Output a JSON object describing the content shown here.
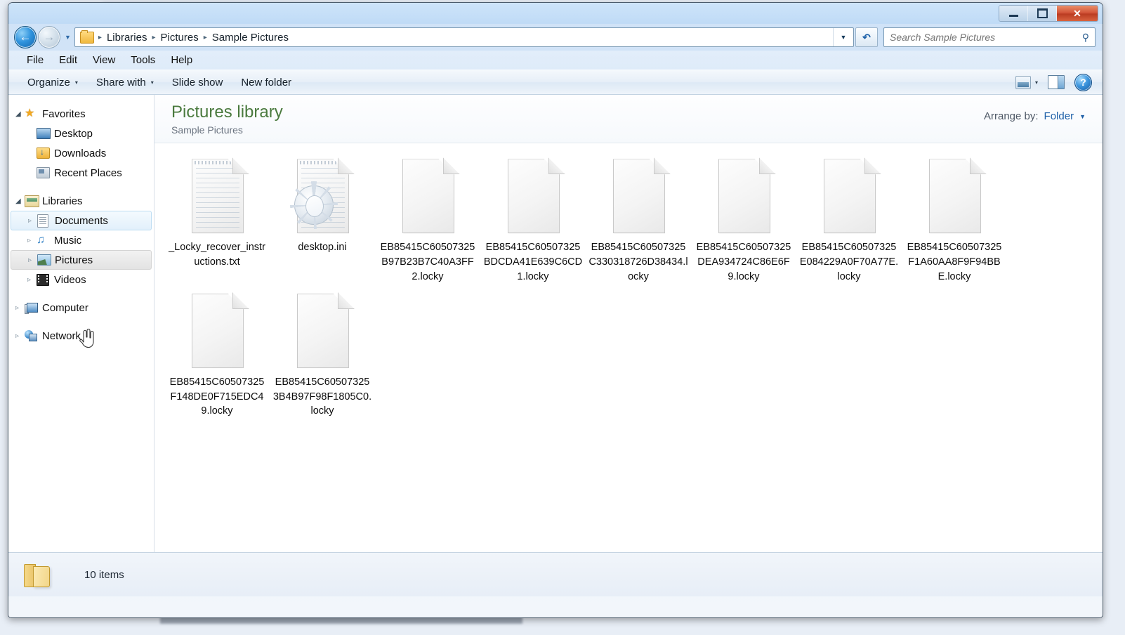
{
  "window": {
    "controls": {
      "minimize": "Minimize",
      "maximize": "Maximize",
      "close": "Close"
    }
  },
  "navigation": {
    "back_label": "Back",
    "forward_label": "Forward",
    "recent_label": "Recent pages",
    "refresh_label": "Refresh",
    "breadcrumbs": [
      "Libraries",
      "Pictures",
      "Sample Pictures"
    ],
    "separator": "▸",
    "dropdown_caret": "▼"
  },
  "search": {
    "placeholder": "Search Sample Pictures",
    "value": "",
    "icon": "search-icon"
  },
  "menubar": {
    "items": [
      "File",
      "Edit",
      "View",
      "Tools",
      "Help"
    ]
  },
  "toolbar": {
    "organize": "Organize",
    "share_with": "Share with",
    "slide_show": "Slide show",
    "new_folder": "New folder",
    "caret": "▾",
    "views_label": "Change your view",
    "preview_label": "Show the preview pane",
    "help_label": "?"
  },
  "sidebar": {
    "groups": [
      {
        "header": {
          "label": "Favorites",
          "icon": "star-icon",
          "expander": "◢"
        },
        "items": [
          {
            "label": "Desktop",
            "icon": "desktop-icon"
          },
          {
            "label": "Downloads",
            "icon": "downloads-icon"
          },
          {
            "label": "Recent Places",
            "icon": "recent-places-icon"
          }
        ]
      },
      {
        "header": {
          "label": "Libraries",
          "icon": "libraries-icon",
          "expander": "◢"
        },
        "items": [
          {
            "label": "Documents",
            "icon": "documents-icon",
            "expander": "▹",
            "state": "hover"
          },
          {
            "label": "Music",
            "icon": "music-icon",
            "expander": "▹",
            "state": "normal"
          },
          {
            "label": "Pictures",
            "icon": "pictures-icon",
            "expander": "▹",
            "state": "selected"
          },
          {
            "label": "Videos",
            "icon": "videos-icon",
            "expander": "▹",
            "state": "normal"
          }
        ]
      },
      {
        "header": {
          "label": "Computer",
          "icon": "computer-icon",
          "expander": "▹"
        },
        "items": []
      },
      {
        "header": {
          "label": "Network",
          "icon": "network-icon",
          "expander": "▹"
        },
        "items": []
      }
    ]
  },
  "library": {
    "title": "Pictures library",
    "subtitle": "Sample Pictures",
    "arrange_label": "Arrange by:",
    "arrange_value": "Folder",
    "arrange_caret": "▼"
  },
  "files": [
    {
      "name": "_Locky_recover_instructions.txt",
      "icon": "text-file-icon"
    },
    {
      "name": "desktop.ini",
      "icon": "configuration-file-icon"
    },
    {
      "name": "EB85415C60507325B97B23B7C40A3FF2.locky",
      "icon": "blank-file-icon"
    },
    {
      "name": "EB85415C60507325BDCDA41E639C6CD1.locky",
      "icon": "blank-file-icon"
    },
    {
      "name": "EB85415C60507325C330318726D38434.locky",
      "icon": "blank-file-icon"
    },
    {
      "name": "EB85415C60507325DEA934724C86E6F9.locky",
      "icon": "blank-file-icon"
    },
    {
      "name": "EB85415C60507325E084229A0F70A77E.locky",
      "icon": "blank-file-icon"
    },
    {
      "name": "EB85415C60507325F1A60AA8F9F94BBE.locky",
      "icon": "blank-file-icon"
    },
    {
      "name": "EB85415C60507325F148DE0F715EDC49.locky",
      "icon": "blank-file-icon"
    },
    {
      "name": "EB85415C605073253B4B97F98F1805C0.locky",
      "icon": "blank-file-icon"
    }
  ],
  "statusbar": {
    "item_count": "10 items",
    "icon": "folder-icon"
  }
}
